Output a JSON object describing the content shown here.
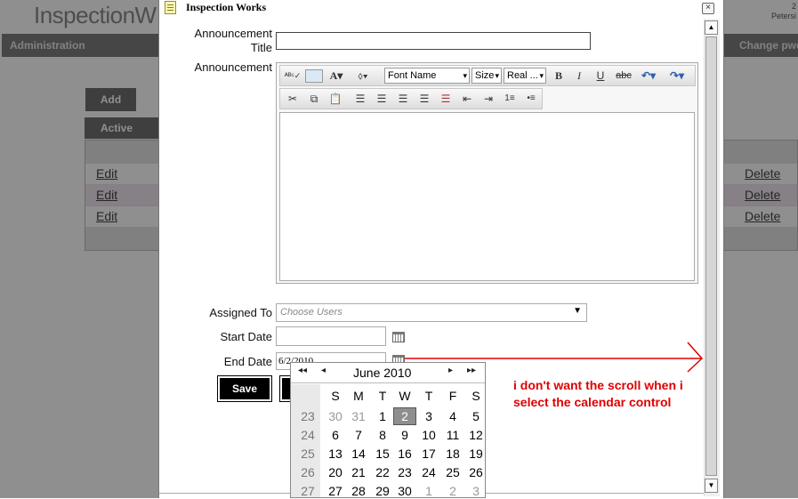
{
  "background": {
    "logo": "InspectionW",
    "top_right_line1": "2",
    "top_right_line2": "Petersi",
    "nav_admin": "Administration",
    "nav_change": "Change pwd",
    "add_label": "Add",
    "active_tab": "Active",
    "rows": [
      {
        "edit": "Edit",
        "delete": "Delete"
      },
      {
        "edit": "Edit",
        "delete": "Delete"
      },
      {
        "edit": "Edit",
        "delete": "Delete"
      }
    ]
  },
  "dialog": {
    "title": "Inspection Works",
    "close_glyph": "×",
    "fields": {
      "title_label_1": "Announcement",
      "title_label_2": "Title",
      "announcement_label": "Announcement",
      "assigned_label": "Assigned To",
      "assigned_placeholder": "Choose Users",
      "start_label": "Start Date",
      "start_value": "",
      "end_label": "End Date",
      "end_value": "6/2/2010"
    },
    "toolbar": {
      "font_name": "Font Name",
      "size": "Size",
      "real": "Real ...",
      "bold": "B",
      "italic": "I",
      "underline": "U",
      "strike": "abc"
    },
    "save_label": "Save"
  },
  "calendar": {
    "title": "June 2010",
    "nav_prev_year": "◂◂",
    "nav_prev": "◂",
    "nav_next": "▸",
    "nav_next_year": "▸▸",
    "day_headers": [
      "S",
      "M",
      "T",
      "W",
      "T",
      "F",
      "S"
    ],
    "weeks": [
      {
        "wk": "23",
        "days": [
          "30",
          "31",
          "1",
          "2",
          "3",
          "4",
          "5"
        ]
      },
      {
        "wk": "24",
        "days": [
          "6",
          "7",
          "8",
          "9",
          "10",
          "11",
          "12"
        ]
      },
      {
        "wk": "25",
        "days": [
          "13",
          "14",
          "15",
          "16",
          "17",
          "18",
          "19"
        ]
      },
      {
        "wk": "26",
        "days": [
          "20",
          "21",
          "22",
          "23",
          "24",
          "25",
          "26"
        ]
      },
      {
        "wk": "27",
        "days": [
          "27",
          "28",
          "29",
          "30",
          "1",
          "2",
          "3"
        ]
      }
    ],
    "selected_day": "2"
  },
  "annotation": {
    "text": "i don't want the scroll when i select the calendar control",
    "color": "#e00000"
  }
}
